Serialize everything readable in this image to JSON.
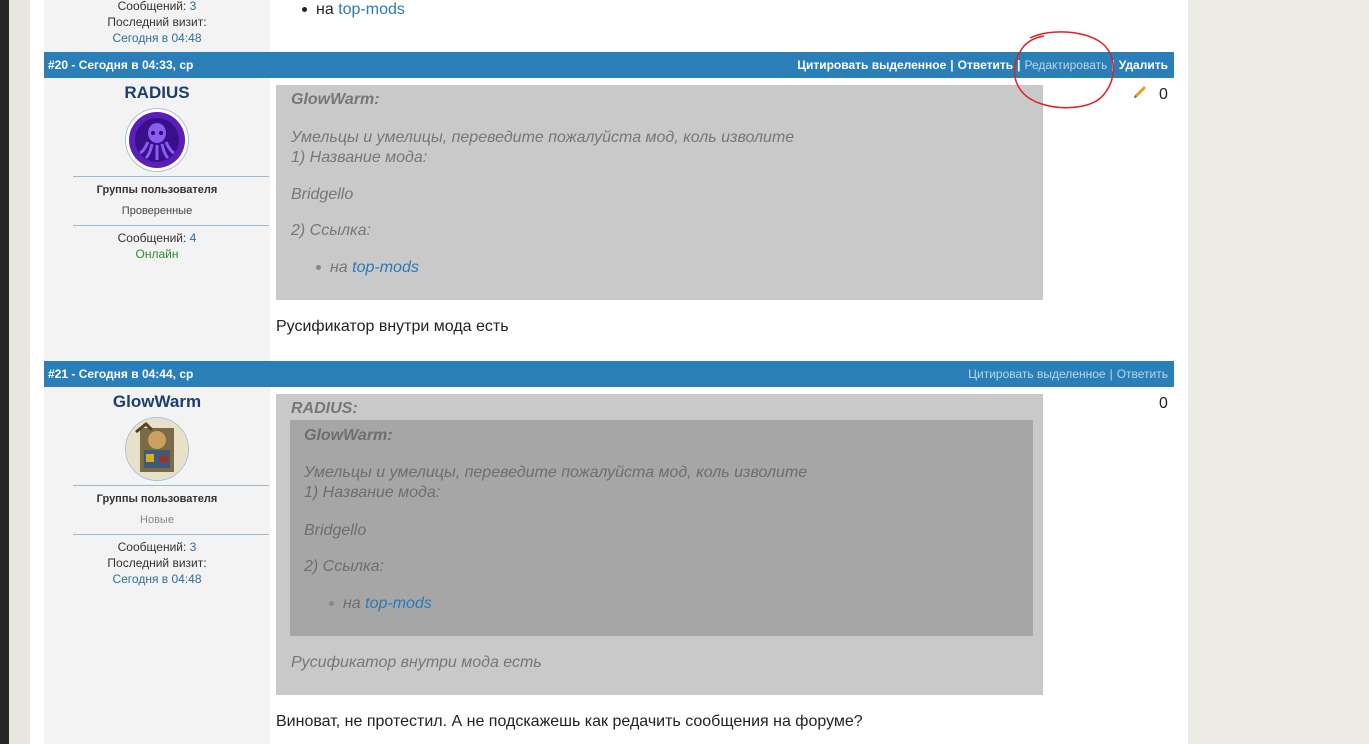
{
  "prev_post": {
    "messages_label": "Сообщений:",
    "messages_count": "3",
    "last_visit_label": "Последний визит:",
    "last_visit_value": "Сегодня в 04:48",
    "list_item_prefix": "на",
    "list_item_link": "top-mods"
  },
  "post20": {
    "number": "#20",
    "date": " - Сегодня в 04:33, ср",
    "actions": [
      "Цитировать выделенное",
      "Ответить",
      "Редактировать",
      "Удалить"
    ],
    "separator": "|",
    "username": "RADIUS",
    "groups_label": "Группы пользователя",
    "group_value": "Проверенные",
    "messages_label": "Сообщений:",
    "messages_count": "4",
    "status": "Онлайн",
    "rating": "0",
    "quote": {
      "author": "GlowWarm:",
      "line1": "Умельцы и умелицы, переведите пожалуйста мод, коль изволите",
      "line2": "1) Название мода:",
      "line3": "Bridgello",
      "line4": "2) Ссылка:",
      "list_prefix": "на",
      "list_link": "top-mods"
    },
    "body": "Русификатор внутри мода есть"
  },
  "post21": {
    "number": "#21",
    "date": " - Сегодня в 04:44, ср",
    "actions": [
      "Цитировать выделенное",
      "Ответить"
    ],
    "separator": "|",
    "username": "GlowWarm",
    "groups_label": "Группы пользователя",
    "group_value": "Новые",
    "messages_label": "Сообщений:",
    "messages_count": "3",
    "last_visit_label": "Последний визит:",
    "last_visit_value": "Сегодня в 04:48",
    "rating": "0",
    "quote": {
      "author": "RADIUS:",
      "inner_author": "GlowWarm:",
      "line1": "Умельцы и умелицы, переведите пожалуйста мод, коль изволите",
      "line2": "1) Название мода:",
      "line3": "Bridgello",
      "line4": "2) Ссылка:",
      "list_prefix": "на",
      "list_link": "top-mods",
      "outer_text": "Русификатор внутри мода есть"
    },
    "body": "Виноват, не протестил. А не подскажешь как редачить сообщения на форуме?"
  },
  "colors": {
    "bar": "#2a7fb8",
    "link": "#2b7ab8",
    "online": "#2e8b2e",
    "annotation": "#e02020"
  }
}
